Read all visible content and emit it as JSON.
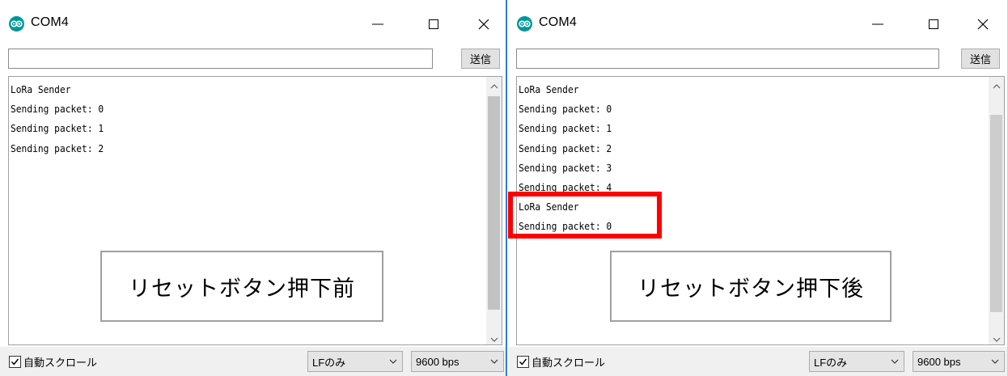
{
  "windows": [
    {
      "title": "COM4",
      "send": {
        "input_value": "",
        "button_label": "送信"
      },
      "output_lines": [
        "LoRa Sender",
        "Sending packet: 0",
        "Sending packet: 1",
        "Sending packet: 2"
      ],
      "caption": "リセットボタン押下前",
      "autoscroll_label": "自動スクロール",
      "autoscroll_checked": true,
      "line_ending": "LFのみ",
      "baud_rate": "9600 bps"
    },
    {
      "title": "COM4",
      "send": {
        "input_value": "",
        "button_label": "送信"
      },
      "output_lines": [
        "LoRa Sender",
        "Sending packet: 0",
        "Sending packet: 1",
        "Sending packet: 2",
        "Sending packet: 3",
        "Sending packet: 4",
        "LoRa Sender",
        "Sending packet: 0"
      ],
      "caption": "リセットボタン押下後",
      "autoscroll_label": "自動スクロール",
      "autoscroll_checked": true,
      "line_ending": "LFのみ",
      "baud_rate": "9600 bps"
    }
  ],
  "icons": {
    "app": "arduino-icon",
    "minimize": "minimize-icon",
    "maximize": "maximize-icon",
    "close": "close-icon",
    "scroll_up": "chevron-up-icon",
    "scroll_down": "chevron-down-icon",
    "checkbox": "checkmark-icon",
    "dropdown": "chevron-down-icon"
  },
  "colors": {
    "arduino_teal": "#00979c",
    "highlight": "#ff0000",
    "window_border": "#2d7fd2"
  }
}
